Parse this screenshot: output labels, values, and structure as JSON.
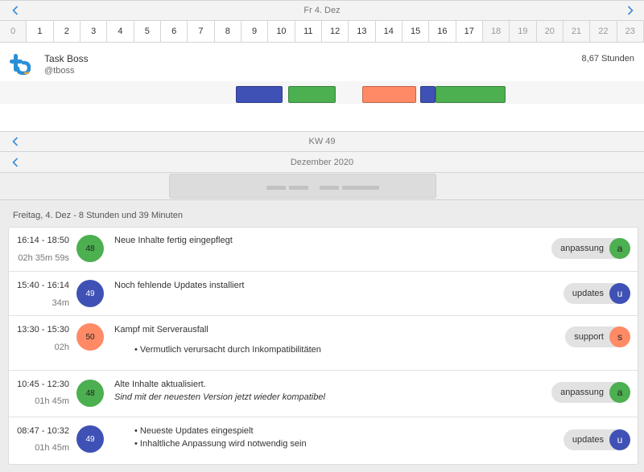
{
  "day_nav": {
    "label": "Fr 4. Dez"
  },
  "hours": [
    "0",
    "1",
    "2",
    "3",
    "4",
    "5",
    "6",
    "7",
    "8",
    "9",
    "10",
    "11",
    "12",
    "13",
    "14",
    "15",
    "16",
    "17",
    "18",
    "19",
    "20",
    "21",
    "22",
    "23"
  ],
  "user": {
    "name": "Task Boss",
    "handle": "@tboss",
    "total_hours": "8,67 Stunden"
  },
  "timeline_blocks": [
    {
      "start": "08:47",
      "end": "10:32",
      "color": "#3f51b5"
    },
    {
      "start": "10:45",
      "end": "12:30",
      "color": "#4caf50"
    },
    {
      "start": "13:30",
      "end": "15:30",
      "color": "#ff8a65"
    },
    {
      "start": "15:40",
      "end": "16:14",
      "color": "#3f51b5"
    },
    {
      "start": "16:14",
      "end": "18:50",
      "color": "#4caf50"
    }
  ],
  "week_nav": {
    "label": "KW 49"
  },
  "month_nav": {
    "label": "Dezember 2020"
  },
  "day_heading": "Freitag, 4. Dez - 8 Stunden und 39 Minuten",
  "colors": {
    "green": "#4caf50",
    "blue": "#3f51b5",
    "orange": "#ff8a65",
    "accent": "#3a8bd6"
  },
  "entries": [
    {
      "time": "16:14 - 18:50",
      "duration": "02h 35m 59s",
      "week": "48",
      "title": "Neue Inhalte fertig eingepflegt",
      "tag": "anpassung",
      "tag_letter": "a"
    },
    {
      "time": "15:40 - 16:14",
      "duration": "34m",
      "week": "49",
      "title": "Noch fehlende Updates installiert",
      "tag": "updates",
      "tag_letter": "u"
    },
    {
      "time": "13:30 - 15:30",
      "duration": "02h",
      "week": "50",
      "title": "Kampf mit Serverausfall",
      "bullet": "• Vermutlich verursacht durch Inkompatibilitäten",
      "tag": "support",
      "tag_letter": "s"
    },
    {
      "time": "10:45 - 12:30",
      "duration": "01h 45m",
      "week": "48",
      "title": "Alte Inhalte aktualisiert.",
      "subtitle": "Sind mit der neuesten Version jetzt wieder kompatibel",
      "tag": "anpassung",
      "tag_letter": "a"
    },
    {
      "time": "08:47 - 10:32",
      "duration": "01h 45m",
      "week": "49",
      "bullet1": "• Neueste Updates eingespielt",
      "bullet2": "• Inhaltliche Anpassung wird notwendig sein",
      "tag": "updates",
      "tag_letter": "u"
    }
  ]
}
